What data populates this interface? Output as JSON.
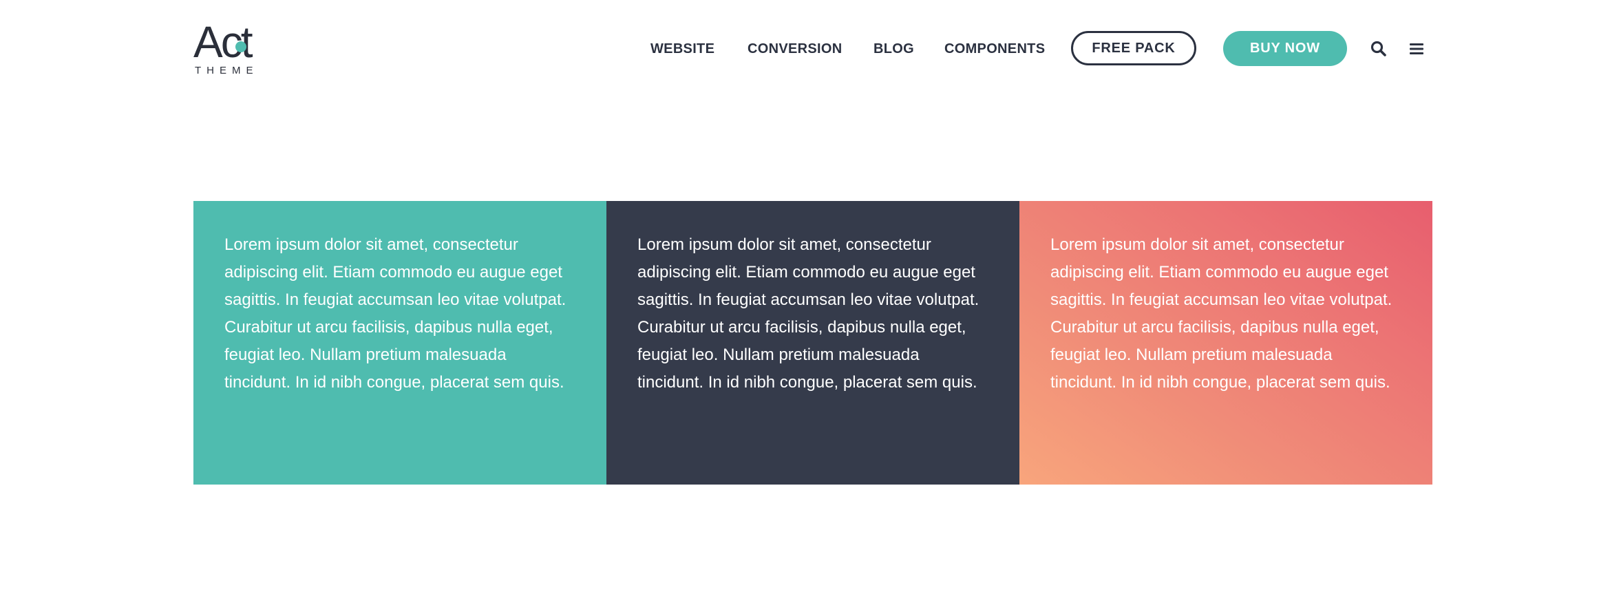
{
  "header": {
    "logo": {
      "word": "Act",
      "subtitle": "THEME"
    },
    "nav": [
      {
        "label": "WEBSITE"
      },
      {
        "label": "CONVERSION"
      },
      {
        "label": "BLOG"
      },
      {
        "label": "COMPONENTS"
      }
    ],
    "free_pack_label": "FREE PACK",
    "buy_now_label": "BUY NOW",
    "icons": [
      "search-icon",
      "menu-icon"
    ]
  },
  "features": [
    {
      "text": "Lorem ipsum dolor sit amet, consectetur adipiscing elit. Etiam commodo eu augue eget sagittis. In feugiat accumsan leo vitae volutpat. Curabitur ut arcu facilisis, dapibus nulla eget, feugiat leo. Nullam pretium malesuada tincidunt. In id nibh congue, placerat sem quis.",
      "color": "#4fbcaf"
    },
    {
      "text": "Lorem ipsum dolor sit amet, consectetur adipiscing elit. Etiam commodo eu augue eget sagittis. In feugiat accumsan leo vitae volutpat. Curabitur ut arcu facilisis, dapibus nulla eget, feugiat leo. Nullam pretium malesuada tincidunt. In id nibh congue, placerat sem quis.",
      "color": "#353b4b"
    },
    {
      "text": "Lorem ipsum dolor sit amet, consectetur adipiscing elit. Etiam commodo eu augue eget sagittis. In feugiat accumsan leo vitae volutpat. Curabitur ut arcu facilisis, dapibus nulla eget, feugiat leo. Nullam pretium malesuada tincidunt. In id nibh congue, placerat sem quis.",
      "color": "gradient #f8a57c to #e75e6e"
    }
  ],
  "colors": {
    "accent": "#4fbcaf",
    "dark": "#353b4b",
    "nav_text": "#2b3140",
    "coral_start": "#f8a57c",
    "coral_end": "#e75e6e"
  }
}
